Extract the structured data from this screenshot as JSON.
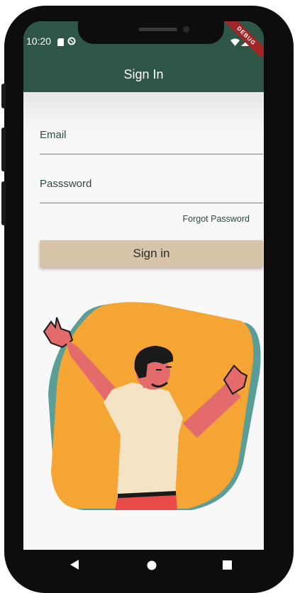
{
  "status_bar": {
    "time": "10:20",
    "left_icons": [
      "sim-card-icon",
      "sync-icon"
    ],
    "right_icons": [
      "wifi-icon",
      "signal-icon"
    ],
    "debug_banner": "DEBUG"
  },
  "app_bar": {
    "title": "Sign In",
    "color": "#2d5647"
  },
  "form": {
    "email_placeholder": "Email",
    "password_placeholder": "Passsword",
    "forgot_password": "Forgot Password",
    "submit_label": "Sign in",
    "button_color": "#d8c4a8"
  },
  "illustration": {
    "subject": "happy-person-illustration",
    "colors": [
      "#f4a534",
      "#5a9e97",
      "#f4e3c4",
      "#e36b6b"
    ]
  },
  "nav_bar": {
    "items": [
      "back-icon",
      "home-icon",
      "recents-icon"
    ]
  }
}
